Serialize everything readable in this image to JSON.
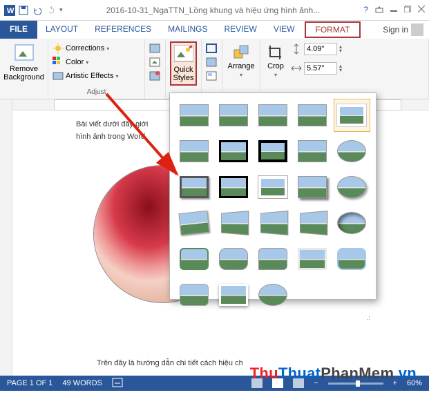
{
  "title": "2016-10-31_NgaTTN_Lồng khung và hiệu ứng hình ảnh...",
  "tabs": {
    "file": "FILE",
    "layout": "LAYOUT",
    "references": "REFERENCES",
    "mailings": "MAILINGS",
    "review": "REVIEW",
    "view": "VIEW",
    "format": "FORMAT"
  },
  "signin": "Sign in",
  "ribbon": {
    "removebg": "Remove\nBackground",
    "corrections": "Corrections",
    "color": "Color",
    "artistic": "Artistic Effects",
    "adjust_label": "Adjust",
    "quick_styles": "Quick\nStyles",
    "arrange": "Arrange",
    "crop": "Crop",
    "height": "4.09\"",
    "width": "5.57\""
  },
  "doc": {
    "line1": "Bài viết dưới đây giới",
    "line2": "hình ảnh trong Word",
    "footer": "Trên đây là hướng dẫn chi tiết cách hiệu ch"
  },
  "status": {
    "page": "PAGE 1 OF 1",
    "words": "49 WORDS",
    "zoom": "60%"
  },
  "watermark": {
    "a": "Thu",
    "b": "Thuat",
    "c": "PhanMem",
    "d": ".vn"
  }
}
